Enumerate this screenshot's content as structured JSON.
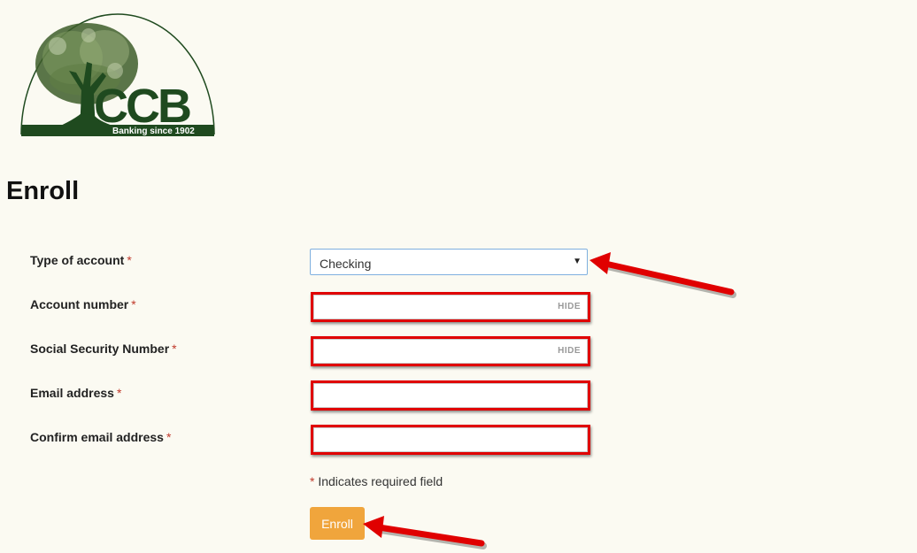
{
  "logo": {
    "text": "CCB",
    "tagline": "Banking since 1902"
  },
  "page_title": "Enroll",
  "form": {
    "account_type": {
      "label": "Type of account",
      "required_mark": "*",
      "value": "Checking"
    },
    "account_number": {
      "label": "Account number",
      "required_mark": "*",
      "toggle": "HIDE",
      "value": ""
    },
    "ssn": {
      "label": "Social Security Number",
      "required_mark": "*",
      "toggle": "HIDE",
      "value": ""
    },
    "email": {
      "label": "Email address",
      "required_mark": "*",
      "value": ""
    },
    "confirm_email": {
      "label": "Confirm email address",
      "required_mark": "*",
      "value": ""
    },
    "required_note": {
      "mark": "*",
      "text": "Indicates required field"
    },
    "submit_label": "Enroll"
  },
  "icons": {
    "select_caret": "chevron-down-icon",
    "annotation": "arrow-icon"
  },
  "colors": {
    "background": "#fbfaf2",
    "brand_green": "#1f4a1f",
    "highlight_red": "#e00000",
    "button_orange": "#f0a53c",
    "required_red": "#c0392b"
  }
}
